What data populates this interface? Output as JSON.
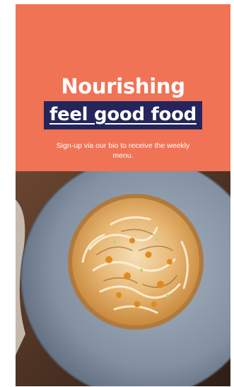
{
  "post": {
    "headline": "Nourishing",
    "highlight": "feel good food",
    "subtext": "Sign-up via our bio to receive the weekly menu."
  },
  "colors": {
    "hero_background": "#f07356",
    "highlight_background": "#25255c",
    "text": "#ffffff"
  },
  "image": {
    "subject": "meringue-tart-on-blue-plate"
  }
}
